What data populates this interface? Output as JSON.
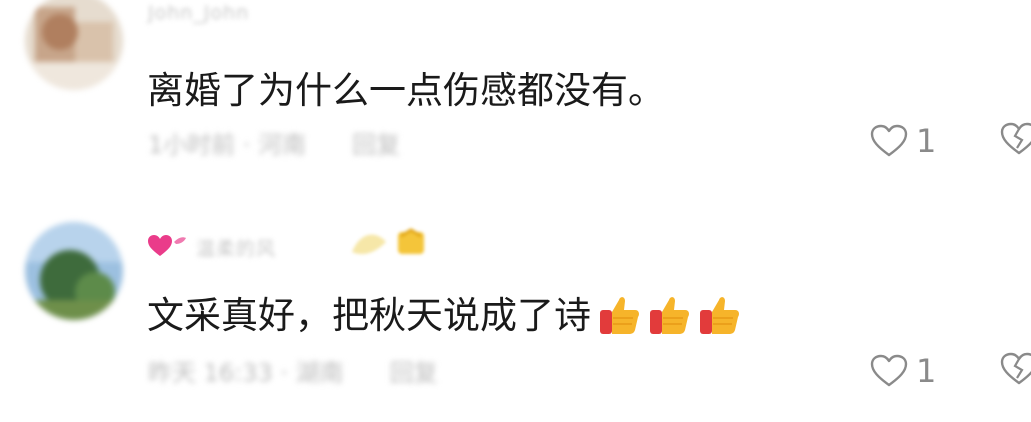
{
  "comments": [
    {
      "username": "John_John",
      "text": "离婚了为什么一点伤感都没有。",
      "time": "1小时前 · 河南",
      "reply": "回复",
      "likes": "1",
      "avatar_colors": [
        "#d8c6b4",
        "#b48a6c",
        "#e4d6c8"
      ]
    },
    {
      "username": "温柔的风",
      "text": "文采真好，把秋天说成了诗",
      "time": "昨天 16:33 · 湖南",
      "reply": "回复",
      "likes": "1",
      "emoji_count": 3,
      "avatar_colors": [
        "#8fb4d8",
        "#3c6a3a",
        "#6f9a58"
      ]
    }
  ]
}
